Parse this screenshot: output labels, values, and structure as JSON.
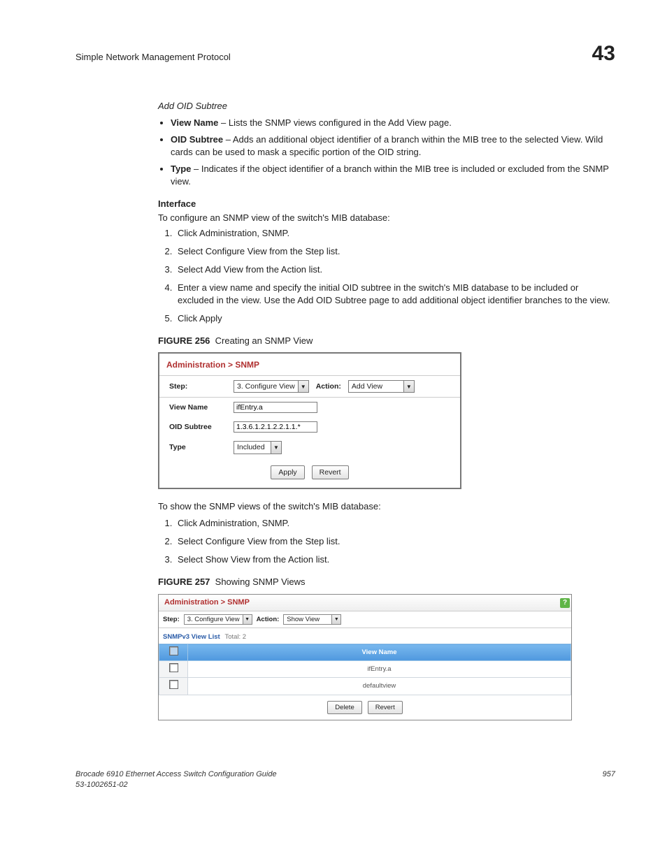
{
  "header": {
    "running": "Simple Network Management Protocol",
    "chapter": "43"
  },
  "sec": {
    "addOid": "Add OID Subtree",
    "bullets": [
      {
        "term": "View Name",
        "text": " – Lists the SNMP views configured in the Add View page."
      },
      {
        "term": "OID Subtree",
        "text": " – Adds an additional object identifier of a branch within the MIB tree to the selected View. Wild cards can be used to mask a specific portion of the OID string."
      },
      {
        "term": "Type",
        "text": " – Indicates if the object identifier of a branch within the MIB tree is included or excluded from the SNMP view."
      }
    ],
    "iface": "Interface",
    "ifaceIntro": "To configure an SNMP view of the switch's MIB database:",
    "steps1": [
      "Click Administration, SNMP.",
      "Select Configure View from the Step list.",
      "Select Add View from the Action list.",
      "Enter a view name and specify the initial OID subtree in the switch's MIB database to be included or excluded in the view. Use the Add OID Subtree page to add additional object identifier branches to the view.",
      "Click Apply"
    ],
    "fig256label": "FIGURE 256",
    "fig256title": "Creating an SNMP View",
    "between": "To show the SNMP views of the switch's MIB database:",
    "steps2": [
      "Click Administration, SNMP.",
      "Select Configure View from the Step list.",
      "Select Show View from the Action list."
    ],
    "fig257label": "FIGURE 257",
    "fig257title": "Showing SNMP Views"
  },
  "fig256": {
    "crumb": "Administration > SNMP",
    "stepLbl": "Step:",
    "stepVal": "3. Configure View",
    "actionLbl": "Action:",
    "actionVal": "Add View",
    "rows": {
      "viewNameLbl": "View Name",
      "viewNameVal": "ifEntry.a",
      "oidLbl": "OID Subtree",
      "oidVal": "1.3.6.1.2.1.2.2.1.1.*",
      "typeLbl": "Type",
      "typeVal": "Included"
    },
    "apply": "Apply",
    "revert": "Revert"
  },
  "fig257": {
    "crumb": "Administration > SNMP",
    "stepLbl": "Step:",
    "stepVal": "3. Configure View",
    "actionLbl": "Action:",
    "actionVal": "Show View",
    "listTitle": "SNMPv3 View List",
    "listTotal": "Total: 2",
    "colView": "View Name",
    "rows": [
      "ifEntry.a",
      "defaultview"
    ],
    "delete": "Delete",
    "revert": "Revert",
    "help": "?"
  },
  "footer": {
    "l1": "Brocade 6910 Ethernet Access Switch Configuration Guide",
    "l2": "53-1002651-02",
    "page": "957"
  }
}
